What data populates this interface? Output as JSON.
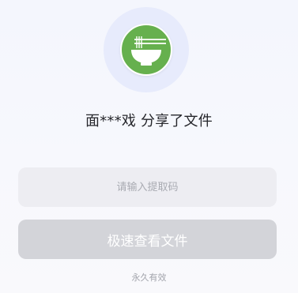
{
  "share": {
    "sharer_text": "面***戏 分享了文件",
    "avatar_icon": "noodle-bowl-icon",
    "avatar_color": "#66b04e"
  },
  "form": {
    "code_placeholder": "请输入提取码",
    "code_value": "",
    "submit_label": "极速查看文件",
    "validity_text": "永久有效"
  }
}
